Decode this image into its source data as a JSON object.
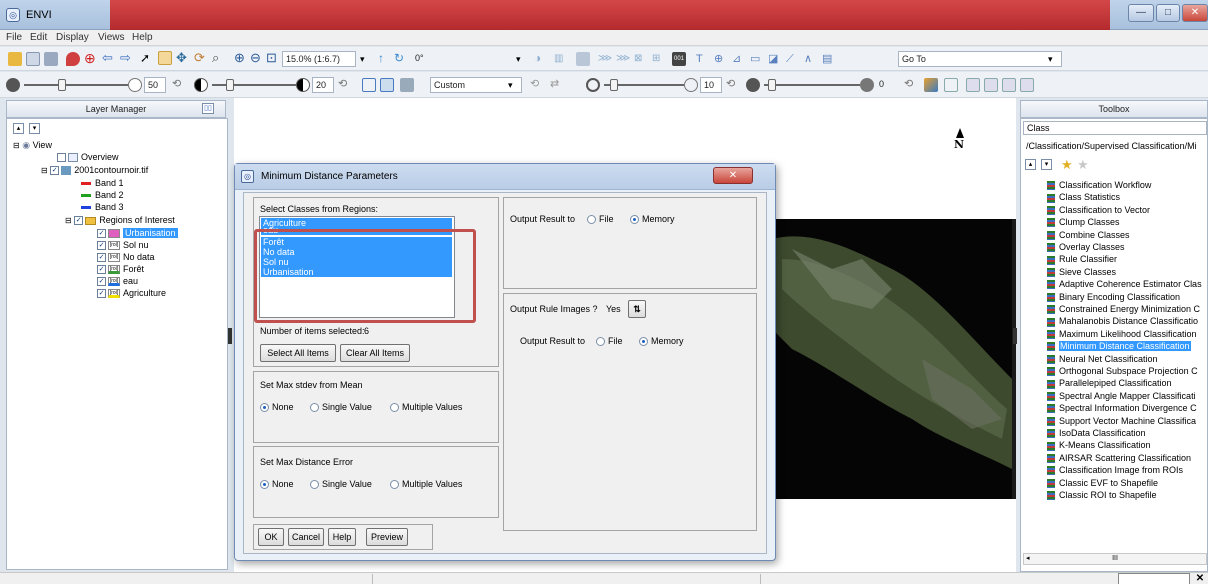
{
  "window": {
    "title": "ENVI",
    "app_icon": "envi-icon"
  },
  "menu": [
    "File",
    "Edit",
    "Display",
    "Views",
    "Help"
  ],
  "toolbar": {
    "zoom": "15.0% (1:6.7)",
    "rotation": "0°",
    "goto": "Go To"
  },
  "toolbar2": {
    "brightness": "50",
    "contrast": "20",
    "stretch": "Custom",
    "sharpen": "10",
    "transparency": "0"
  },
  "layer_manager": {
    "title": "Layer Manager",
    "view": "View",
    "overview": "Overview",
    "file": "2001contournoir.tif",
    "bands": [
      {
        "label": "Band 1",
        "color": "#e02020"
      },
      {
        "label": "Band 2",
        "color": "#20a020"
      },
      {
        "label": "Band 3",
        "color": "#2040e0"
      }
    ],
    "roi_group": "Regions of Interest",
    "rois": [
      {
        "label": "Urbanisation",
        "selected": true,
        "color": "#e060c0"
      },
      {
        "label": "Sol nu",
        "color": "#ffffff"
      },
      {
        "label": "No data",
        "color": "#ffffff"
      },
      {
        "label": "Forêt",
        "color": "#3a9a3a"
      },
      {
        "label": "eau",
        "color": "#1e6ee0"
      },
      {
        "label": "Agriculture",
        "color": "#f0e000"
      }
    ],
    "roi_icon_text": "[roi]"
  },
  "map": {
    "north_label": "N"
  },
  "toolbox": {
    "title": "Toolbox",
    "search": "Class",
    "path": "/Classification/Supervised Classification/Mi",
    "items": [
      "Classification Workflow",
      "Class Statistics",
      "Classification to Vector",
      "Clump Classes",
      "Combine Classes",
      "Overlay Classes",
      "Rule Classifier",
      "Sieve Classes",
      "Adaptive Coherence Estimator Clas",
      "Binary Encoding Classification",
      "Constrained Energy Minimization C",
      "Mahalanobis Distance Classificatio",
      "Maximum Likelihood Classification",
      "Minimum Distance Classification",
      "Neural Net Classification",
      "Orthogonal Subspace Projection C",
      "Parallelepiped Classification",
      "Spectral Angle Mapper Classificati",
      "Spectral Information Divergence C",
      "Support Vector Machine Classifica",
      "IsoData Classification",
      "K-Means Classification",
      "AIRSAR Scattering Classification",
      "Classification Image from ROIs",
      "Classic EVF to Shapefile",
      "Classic ROI to Shapefile"
    ],
    "selected_index": 13,
    "scroll_dots": "III"
  },
  "dialog": {
    "title": "Minimum Distance Parameters",
    "close": "✕",
    "select_label": "Select Classes from Regions:",
    "classes": [
      "Agriculture",
      "eau",
      "Forêt",
      "No data",
      "Sol nu",
      "Urbanisation"
    ],
    "items_selected_label": "Number of items selected:",
    "items_selected": "6",
    "select_all": "Select All Items",
    "clear_all": "Clear All Items",
    "output1_label": "Output Result to",
    "file_opt": "File",
    "memory_opt": "Memory",
    "rule_label": "Output Rule Images ?",
    "rule_value": "Yes",
    "rule_toggle": "⇅",
    "output2_label": "Output Result to",
    "stdev_title": "Set Max stdev from Mean",
    "dist_title": "Set Max Distance Error",
    "none_opt": "None",
    "single_opt": "Single Value",
    "multiple_opt": "Multiple Values",
    "ok": "OK",
    "cancel": "Cancel",
    "help": "Help",
    "preview": "Preview"
  },
  "status": {
    "close_glyph": "✕"
  },
  "colors": {
    "highlight": "#c0504d",
    "selection": "#3399ff",
    "titlebar_red": "#c42a2a"
  }
}
